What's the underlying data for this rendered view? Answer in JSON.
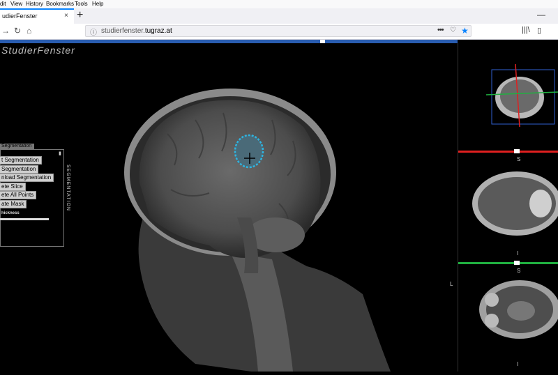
{
  "menu": {
    "items": [
      {
        "label": "dit",
        "u": ""
      },
      {
        "label": "View",
        "u": "V"
      },
      {
        "label": "History",
        "u": "s"
      },
      {
        "label": "Bookmarks",
        "u": "B"
      },
      {
        "label": "Tools",
        "u": "T"
      },
      {
        "label": "Help",
        "u": "H"
      }
    ]
  },
  "tab": {
    "title": "udierFenster",
    "close": "×"
  },
  "newtab": "+",
  "window": {
    "minimize": "—"
  },
  "nav": {
    "back": "→",
    "reload": "↻",
    "home": "⌂",
    "url_prefix": "studierfenster.",
    "url_domain": "tugraz.at",
    "dots": "•••"
  },
  "app": {
    "logo": "StudierFenster"
  },
  "segmentation": {
    "header": "Segmentation",
    "buttons": [
      "t Segmentation",
      "Segmentation",
      "nload Segmentation",
      "ete Slice",
      "ete All Points",
      "ate Mask"
    ],
    "thickness_label": "hickness",
    "vertical_label": "SEGMENTATION"
  },
  "orientation": {
    "left": "L",
    "axial_top": "S",
    "axial_bottom": "I",
    "coronal_top": "S",
    "coronal_bottom": "I"
  },
  "colors": {
    "accent": "#2a5db0",
    "tumor": "#2fb4e0",
    "red_bar": "#e02020",
    "green_bar": "#20b040",
    "firefox_blue": "#0a84ff"
  }
}
